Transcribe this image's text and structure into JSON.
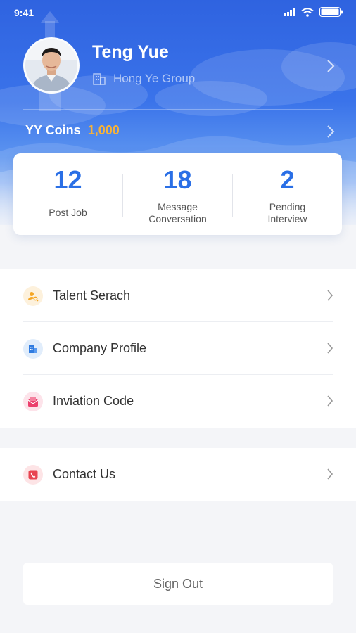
{
  "status_bar": {
    "time": "9:41"
  },
  "profile": {
    "name": "Teng Yue",
    "company": "Hong Ye Group"
  },
  "coins": {
    "label": "YY Coins",
    "value": "1,000"
  },
  "stats": [
    {
      "value": "12",
      "label": "Post Job"
    },
    {
      "value": "18",
      "label": "Message\nConversation"
    },
    {
      "value": "2",
      "label": "Pending\nInterview"
    }
  ],
  "menu": {
    "group1": [
      {
        "label": "Talent Serach",
        "icon": "talent-search-icon",
        "color": "#f5a623",
        "bg": "#fdf1dc"
      },
      {
        "label": "Company Profile",
        "icon": "company-icon",
        "color": "#2f7be0",
        "bg": "#e1edfb"
      },
      {
        "label": "Inviation Code",
        "icon": "invitation-icon",
        "color": "#ec3f6c",
        "bg": "#fde3ea"
      }
    ],
    "group2": [
      {
        "label": "Contact Us",
        "icon": "phone-icon",
        "color": "#e84350",
        "bg": "#fde4e6"
      }
    ]
  },
  "sign_out": "Sign Out",
  "colors": {
    "primary": "#2a6fe6",
    "coins": "#f6b23a"
  }
}
